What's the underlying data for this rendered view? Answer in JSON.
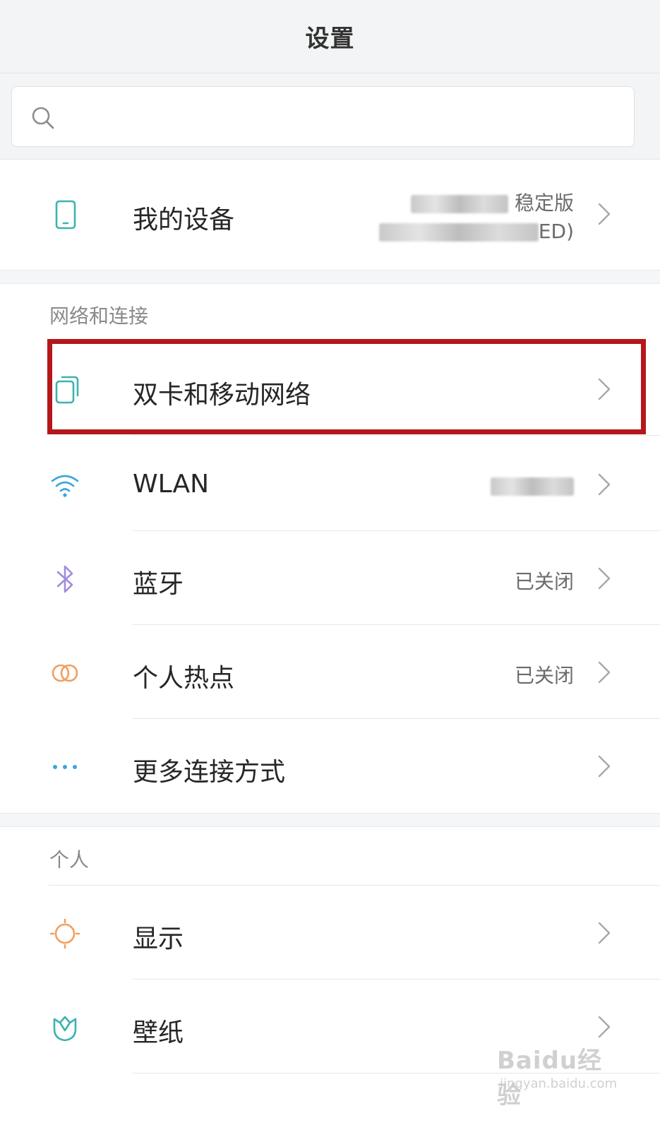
{
  "header": {
    "title": "设置"
  },
  "search": {
    "placeholder": ""
  },
  "device": {
    "label": "我的设备",
    "version_line1_suffix": "稳定版",
    "version_line2_suffix": "ED)"
  },
  "network_section": {
    "header": "网络和连接",
    "items": [
      {
        "label": "双卡和移动网络",
        "value": ""
      },
      {
        "label": "WLAN",
        "value": ""
      },
      {
        "label": "蓝牙",
        "value": "已关闭"
      },
      {
        "label": "个人热点",
        "value": "已关闭"
      },
      {
        "label": "更多连接方式",
        "value": ""
      }
    ]
  },
  "personal_section": {
    "header": "个人",
    "items": [
      {
        "label": "显示",
        "value": ""
      },
      {
        "label": "壁纸",
        "value": ""
      }
    ]
  },
  "watermark": {
    "main": "Baidu经验",
    "sub": "jingyan.baidu.com"
  },
  "colors": {
    "highlight": "#b5171b",
    "icon_teal": "#3bb3b0",
    "icon_blue": "#3aa6d9",
    "icon_purple": "#a08be0",
    "icon_orange": "#f0a060"
  },
  "icons": {
    "search": "search-icon",
    "device": "phone-icon",
    "dual_sim": "sim-card-icon",
    "wlan": "wifi-icon",
    "bluetooth": "bluetooth-icon",
    "hotspot": "hotspot-icon",
    "more": "more-dots-icon",
    "display": "sun-icon",
    "wallpaper": "wallpaper-icon",
    "chevron": "chevron-right-icon"
  }
}
